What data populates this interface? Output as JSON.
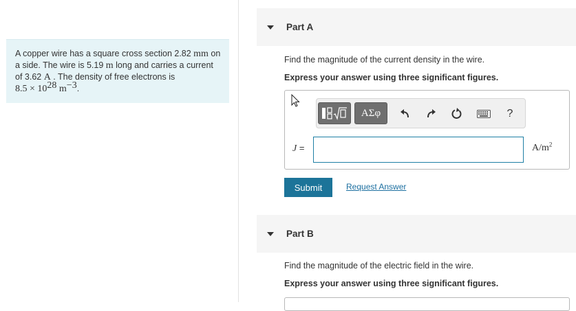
{
  "problem": {
    "text_1": "A copper wire has a square cross section 2.82 ",
    "unit_mm": "mm",
    "text_2": " on a side. The wire is 5.19 ",
    "unit_m": "m",
    "text_3": " long and carries a current of 3.62 ",
    "unit_A": "A",
    "text_4": " . The density of free electrons is ",
    "density_mantissa": "8.5 × 10",
    "density_exp": "28",
    "density_unit": " m",
    "density_unit_exp": "−3",
    "text_end": "."
  },
  "part_a": {
    "title": "Part A",
    "question": "Find the magnitude of the current density in the wire.",
    "instruction": "Express your answer using three significant figures.",
    "toolbar": {
      "templates_icon": "fraction-root-template-icon",
      "greek_label": "ΑΣφ",
      "undo_icon": "undo-icon",
      "redo_icon": "redo-icon",
      "reset_icon": "reset-icon",
      "keyboard_icon": "keyboard-icon",
      "help_label": "?"
    },
    "answer_label": "J",
    "answer_equals": " =",
    "answer_value": "",
    "unit_base": "A/m",
    "unit_exp": "2",
    "submit_label": "Submit",
    "request_label": "Request Answer"
  },
  "part_b": {
    "title": "Part B",
    "question": "Find the magnitude of the electric field in the wire.",
    "instruction": "Express your answer using three significant figures."
  },
  "colors": {
    "problem_bg": "#e6f4f7",
    "part_header_bg": "#f5f5f5",
    "submit_bg": "#1c7499",
    "link": "#1c6fa0",
    "input_border": "#1e7fa5"
  }
}
